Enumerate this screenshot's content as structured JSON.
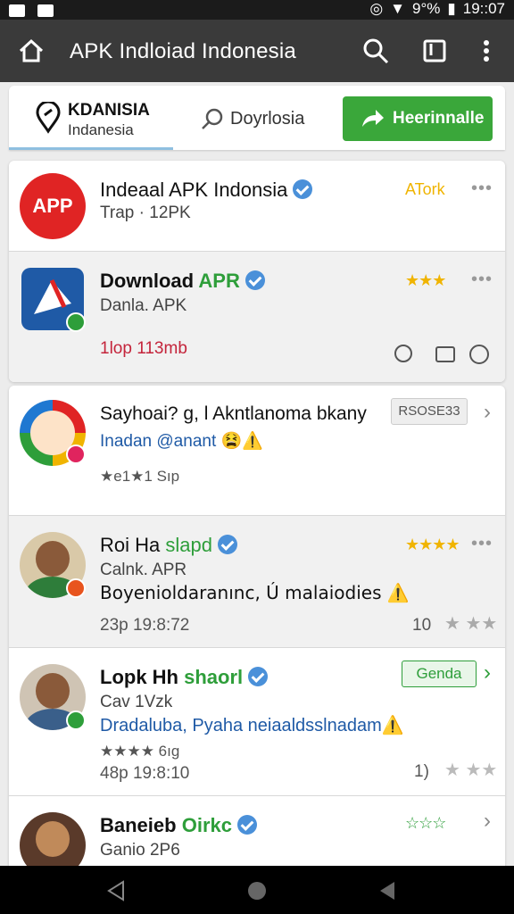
{
  "status": {
    "battery": "9°%",
    "time": "19::07"
  },
  "appbar": {
    "title": "APK Indloiad Indonesia"
  },
  "tabs": {
    "tab1_top": "KDANISIA",
    "tab1_bottom": "Indanesia",
    "tab2": "Doyrlosia",
    "button": "Heerinnalle"
  },
  "items": [
    {
      "name": "Indeaal APK Indonsia",
      "sub": "Trap · 12PK",
      "tag": "ATork"
    },
    {
      "name": "Download",
      "name_accent": "APR",
      "sub": "Danla. APK",
      "meta": "1lop  113mb",
      "stars": "★★★"
    },
    {
      "name": "Sayhoai? g, l Akntlanoma bkany",
      "sub": "Inadan @anant 😫⚠️",
      "rating": "★e1★1 Sıp",
      "tag": "RSOSE33"
    },
    {
      "name": "Roi Ha",
      "name_accent": "slapd",
      "sub": "Calnk. APR",
      "desc": "Boyenioldaranınc, Ú malaiodies ⚠️",
      "meta": "23p  19:8:72",
      "count": "10",
      "stars": "★★★★"
    },
    {
      "name": "Lopk Hh",
      "name_accent": "shaorl",
      "sub": "Cav  1Vzk",
      "desc": "Dradaluba, Pyaha neiaaldsslnadam⚠️",
      "rating": "★★★★ 6ıg",
      "meta": "48p  19:8:10",
      "count": "1)",
      "tag": "Genda"
    },
    {
      "name": "Baneieb",
      "name_accent": "Oirkc",
      "sub": "Ganio  2P6",
      "stars": "☆☆☆"
    }
  ],
  "colors": {
    "accent_green": "#3aa73a",
    "verify_blue": "#4a90d9",
    "star": "#f0b400"
  }
}
